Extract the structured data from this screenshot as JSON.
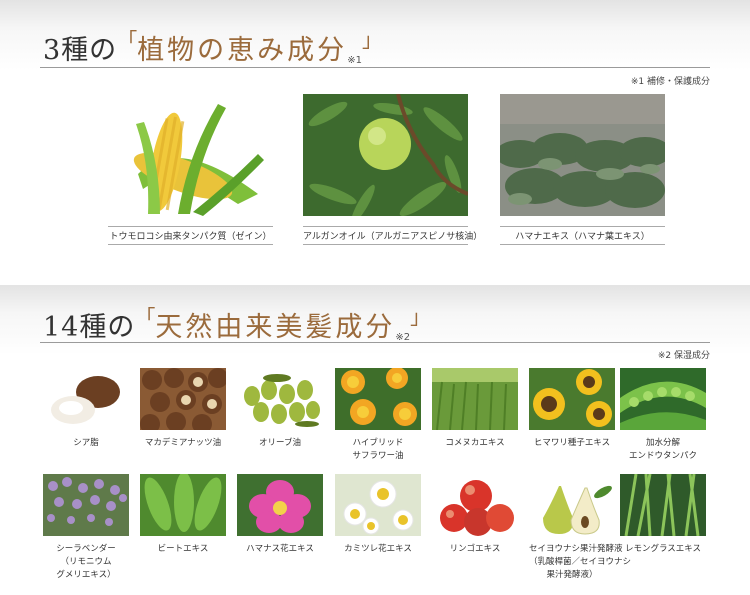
{
  "section1": {
    "count": "3種の",
    "open_quote": "「",
    "name": "植物の恵み成分",
    "ref": "※1",
    "close_quote": "」",
    "note": "※1 補修・保護成分",
    "items": [
      {
        "caption": "トウモロコシ由来タンパク質（ゼイン）"
      },
      {
        "caption": "アルガンオイル（アルガニアスピノサ核油）"
      },
      {
        "caption": "ハマナエキス（ハマナ葉エキス）"
      }
    ]
  },
  "section2": {
    "count": "14種の",
    "open_quote": "「",
    "name": "天然由来美髪成分",
    "ref": "※2",
    "close_quote": "」",
    "note": "※2 保湿成分",
    "items": [
      {
        "lines": [
          "シア脂"
        ]
      },
      {
        "lines": [
          "マカデミアナッツ油"
        ]
      },
      {
        "lines": [
          "オリーブ油"
        ]
      },
      {
        "lines": [
          "ハイブリッド",
          "サフラワー油"
        ]
      },
      {
        "lines": [
          "コメヌカエキス"
        ]
      },
      {
        "lines": [
          "ヒマワリ種子エキス"
        ]
      },
      {
        "lines": [
          "加水分解",
          "エンドウタンパク"
        ]
      },
      {
        "lines": [
          "シーラベンダー",
          "（リモニウム",
          "グメリエキス）"
        ]
      },
      {
        "lines": [
          "ビートエキス"
        ]
      },
      {
        "lines": [
          "ハマナス花エキス"
        ]
      },
      {
        "lines": [
          "カミツレ花エキス"
        ]
      },
      {
        "lines": [
          "リンゴエキス"
        ]
      },
      {
        "lines": [
          "セイヨウナシ果汁発酵液",
          "（乳酸桿菌／セイヨウナシ",
          "果汁発酵液）"
        ]
      },
      {
        "lines": [
          "レモングラスエキス"
        ]
      }
    ]
  },
  "colors": {
    "accent": "#9b6b3c",
    "rule": "#9a9a9a"
  }
}
